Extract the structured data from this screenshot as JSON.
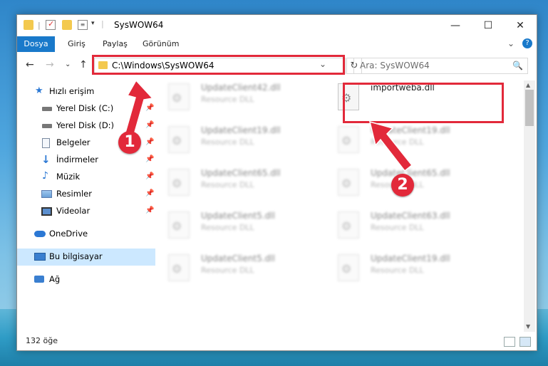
{
  "window": {
    "title": "SysWOW64",
    "buttons": {
      "minimize": "—",
      "maximize": "☐",
      "close": "✕"
    }
  },
  "ribbon": {
    "file_tab": "Dosya",
    "tabs": [
      "Giriş",
      "Paylaş",
      "Görünüm"
    ],
    "expand": "⌄",
    "help": "?"
  },
  "nav": {
    "back": "←",
    "forward": "→",
    "recent": "⌄",
    "up": "↑",
    "address": "C:\\Windows\\SysWOW64",
    "address_chevron": "⌄",
    "refresh": "↻",
    "search_placeholder": "Ara: SysWOW64",
    "search_icon": "🔍"
  },
  "sidebar": {
    "items": [
      {
        "label": "Hızlı erişim",
        "icon": "star-icon",
        "pinned": false
      },
      {
        "label": "Yerel Disk (C:)",
        "icon": "drive-icon",
        "pinned": true
      },
      {
        "label": "Yerel Disk (D:)",
        "icon": "drive-icon",
        "pinned": true
      },
      {
        "label": "Belgeler",
        "icon": "documents-icon",
        "pinned": true
      },
      {
        "label": "İndirmeler",
        "icon": "download-icon",
        "pinned": true
      },
      {
        "label": "Müzik",
        "icon": "music-icon",
        "pinned": true
      },
      {
        "label": "Resimler",
        "icon": "pictures-icon",
        "pinned": true
      },
      {
        "label": "Videolar",
        "icon": "video-icon",
        "pinned": true
      },
      {
        "label": "OneDrive",
        "icon": "cloud-icon",
        "pinned": false
      },
      {
        "label": "Bu bilgisayar",
        "icon": "computer-icon",
        "pinned": false,
        "selected": true
      },
      {
        "label": "Ağ",
        "icon": "network-icon",
        "pinned": false
      }
    ],
    "pin_glyph": "📌"
  },
  "files": [
    {
      "name": "UpdateClient42.dll",
      "desc": "Resource DLL",
      "blurred": true
    },
    {
      "name": "importweba.dll",
      "desc": "",
      "blurred": false
    },
    {
      "name": "UpdateClient19.dll",
      "desc": "Resource DLL",
      "blurred": true
    },
    {
      "name": "UpdateClient19.dll",
      "desc": "Resource DLL",
      "blurred": true
    },
    {
      "name": "UpdateClient65.dll",
      "desc": "Resource DLL",
      "blurred": true
    },
    {
      "name": "UpdateClient65.dll",
      "desc": "Resource DLL",
      "blurred": true
    },
    {
      "name": "UpdateClient5.dll",
      "desc": "Resource DLL",
      "blurred": true
    },
    {
      "name": "UpdateClient63.dll",
      "desc": "Resource DLL",
      "blurred": true
    },
    {
      "name": "UpdateClient5.dll",
      "desc": "Resource DLL",
      "blurred": true
    },
    {
      "name": "UpdateClient19.dll",
      "desc": "Resource DLL",
      "blurred": true
    }
  ],
  "status": {
    "count": "132 öğe"
  },
  "annotations": {
    "step1": "1",
    "step2": "2",
    "color": "#e2293a"
  },
  "colors": {
    "accent": "#1979ca",
    "selection": "#cce8ff",
    "highlight": "#e2293a",
    "folder": "#f3c94f"
  }
}
